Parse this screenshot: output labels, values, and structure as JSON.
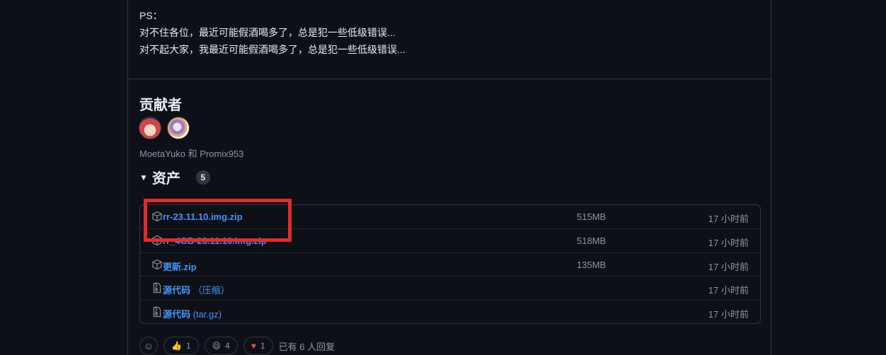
{
  "notes": {
    "lines": [
      "PS：",
      "对不住各位，最近可能假酒喝多了，总是犯一些低级错误...",
      "对不起大家，我最近可能假酒喝多了，总是犯一些低级错误..."
    ]
  },
  "contributors": {
    "title": "贡献者",
    "names": "MoetaYuko 和 Promix953",
    "avatars": [
      "MoetaYuko",
      "Promix953"
    ]
  },
  "assets": {
    "title": "资产",
    "count": "5",
    "items": [
      {
        "name": "rr-23.11.10.img.zip",
        "sub": "",
        "size": "515MB",
        "time": "17 小时前",
        "icon": "package-icon"
      },
      {
        "name": "rr_4GB-23.11.10.img.zip",
        "sub": "",
        "size": "518MB",
        "time": "17 小时前",
        "icon": "package-icon"
      },
      {
        "name": "更新.zip",
        "sub": "",
        "size": "135MB",
        "time": "17 小时前",
        "icon": "package-icon"
      },
      {
        "name": "源代码",
        "sub": " （压缩）",
        "size": "",
        "time": "17 小时前",
        "icon": "file-zip-icon"
      },
      {
        "name": "源代码",
        "sub": " (tar.gz)",
        "size": "",
        "time": "17 小时前",
        "icon": "file-zip-icon"
      }
    ]
  },
  "reactions": {
    "thumbs_up": "1",
    "smile": "4",
    "heart": "1",
    "summary": "已有 6 人回复"
  },
  "colors": {
    "background": "#0d1117",
    "link": "#4493f8",
    "muted": "#8d96a0",
    "highlight": "#e42a2a"
  }
}
